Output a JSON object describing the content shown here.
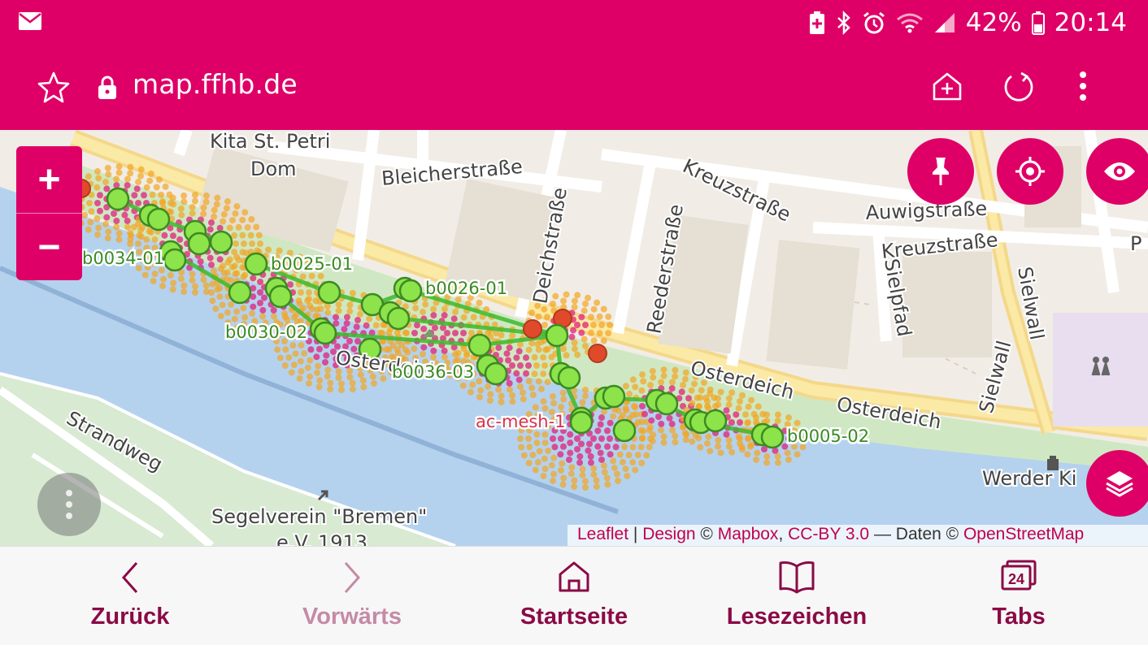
{
  "statusbar": {
    "battery": "42%",
    "time": "20:14",
    "icons": [
      "mail-icon",
      "battery-saver-icon",
      "bluetooth-icon",
      "alarm-icon",
      "wifi-icon",
      "signal-icon",
      "battery-icon"
    ]
  },
  "addressbar": {
    "url": "map.ffhb.de",
    "icons": [
      "star-icon",
      "lock-icon",
      "add-home-icon",
      "reload-icon",
      "menu-icon"
    ]
  },
  "map": {
    "zoom_in": "+",
    "zoom_out": "−",
    "street_labels": {
      "kita": "Kita St. Petri",
      "dom": "Dom",
      "bleicher": "Bleicherstraße",
      "deich": "Deichstraße",
      "kreuz1": "Kreuzstraße",
      "auwig": "Auwigstraße",
      "kreuz2": "Kreuzstraße",
      "reeder": "Reederstraße",
      "sielpfad": "Sielpfad",
      "sielwall1": "Sielwall",
      "sielwall2": "Sielwall",
      "osterdeich1": "Osterdeich",
      "osterdeich2": "Osterdeich",
      "osterdeich_park": "Osterdeich",
      "strandweg": "Strandweg",
      "segelverein": "Segelverein \"Bremen\"",
      "segelverein2": "e.V. 1913",
      "werder": "Werder Ki",
      "p": "P"
    },
    "node_labels": {
      "b0034": "b0034-01",
      "b0025": "b0025-01",
      "b0026": "b0026-01",
      "b0030": "b0030-02",
      "b0036": "b0036-03",
      "acmesh": "ac-mesh-1",
      "b0005": "b0005-02"
    },
    "attribution": {
      "leaflet": "Leaflet",
      "sep": " | ",
      "design": "Design",
      "copy1": " © ",
      "mapbox": "Mapbox",
      "ccby": "CC-BY 3.0",
      "daten": " — Daten © ",
      "osm": "OpenStreetMap"
    },
    "buttons": [
      "pin-icon",
      "locate-icon",
      "eye-icon",
      "layers-icon",
      "more-vertical-icon"
    ],
    "colors": {
      "accent": "#df0067",
      "node_online": "#8de34a",
      "node_offline": "#e04a2a",
      "link": "#3dbb2c"
    }
  },
  "bottomnav": {
    "back": "Zurück",
    "forward": "Vorwärts",
    "home": "Startseite",
    "bookmarks": "Lesezeichen",
    "tabs": "Tabs",
    "tab_count": "24"
  }
}
